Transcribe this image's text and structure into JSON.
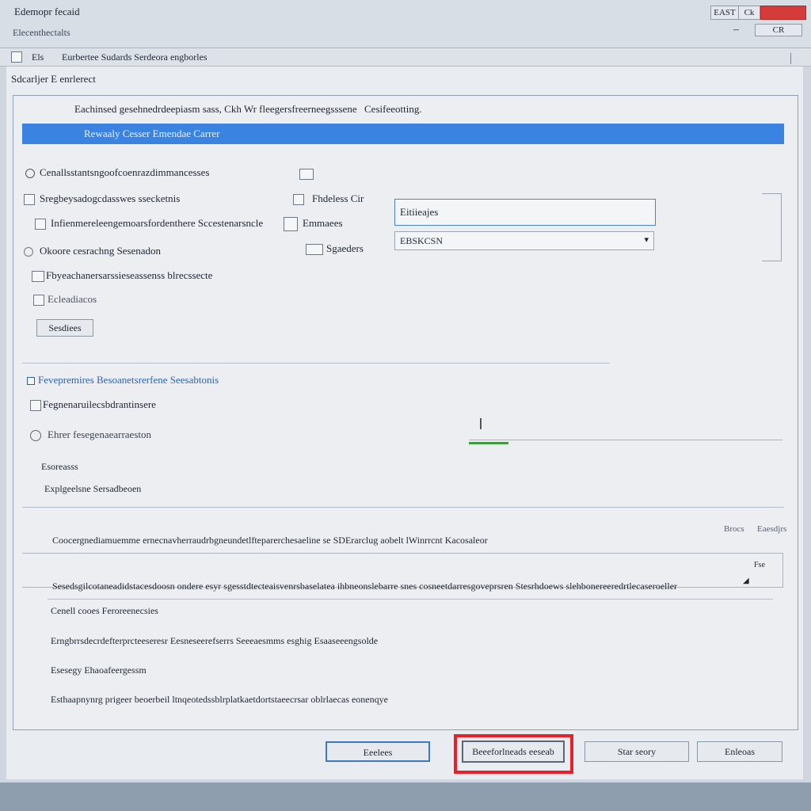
{
  "window": {
    "title": "Edemopr fecaid",
    "subtitle": "Elecenthectalts",
    "minimize_label": "–",
    "restore_label": "CR",
    "top_buttons": [
      "EAST",
      "Ck"
    ]
  },
  "toolbar": {
    "label": "Els",
    "path": "Eurbertee Sudards Serdeora engborles"
  },
  "section_title": "Sdcarljer E enrlerect",
  "panel_header": {
    "left": "Eachinsed gesehnedrdeepiasm sass, Ckh Wr fleegersfreerneegsssene",
    "right": "Cesifeeotting."
  },
  "highlight_label": "Rewaaly Cesser Emendae Carrer",
  "options": [
    "Cenallsstantsngoofcoenrazdimmancesses",
    "Sregbeysadogcdasswes ssecketnis",
    "Infienmereleengemoarsfordenthere Sccestenarsncle",
    "Okoore cesrachng Sesenadon",
    "Fbyeachanersarssieseassenss blrecssecte",
    "Ecleadiacos"
  ],
  "option_button": "Sesdiees",
  "mid_items": [
    "Fhdeless Cir",
    "Emmaees",
    "Sgaeders"
  ],
  "fields": {
    "input_value": "Eitiieajes",
    "select_value": "EBSKCSN"
  },
  "section2": {
    "title": "Fevepremires Besoanetsrerfene Seesabtonis",
    "line1": "Fegnenaruilecsbdrantinsere",
    "line2": "Ehrer fesegenaearraeston",
    "line3": "Esoreasss",
    "line4": "Explgeelsne Sersadbeoen"
  },
  "section3": {
    "tags": [
      "Brocs",
      "Eaesdjrs"
    ],
    "line1": "Coocergnediamuemme ernecnavherraudrbgneundetlfteparerchesaeline se SDErarclug aobelt lWinrrcnt Kacosaleor",
    "line2": "Sesedsgilcotaneadidstacesdoosn ondere esyr sgesstdtecteaisvenrsbaselatea ihbneonslebarre snes cosneetdarresgoveprsren Stesrhdoews slehbonereeredrtlecaseroeller",
    "field_label": "Fse",
    "line3": "Cenell cooes Feroreenecsies",
    "line4": "Erngbrrsdecrdefterprcteeseresr Eesneseerefserrs Seeeaesmms esghig Esaaseeengsolde",
    "line5": "Esesegy Ehaoafeergessm",
    "line6": "Esthaapnynrg prigeer beoerbeil ltnqeotedssblrplatkaetdortstaeecrsar oblrlaecas eonenqye"
  },
  "buttons": {
    "b1": "Eeelees",
    "b2": "Beeeforlneads eeseab",
    "b3": "Star seory",
    "b4": "Enleoas"
  },
  "colors": {
    "accent": "#3a83e0",
    "highlight_box": "#e8202a",
    "close": "#d63b3b"
  }
}
